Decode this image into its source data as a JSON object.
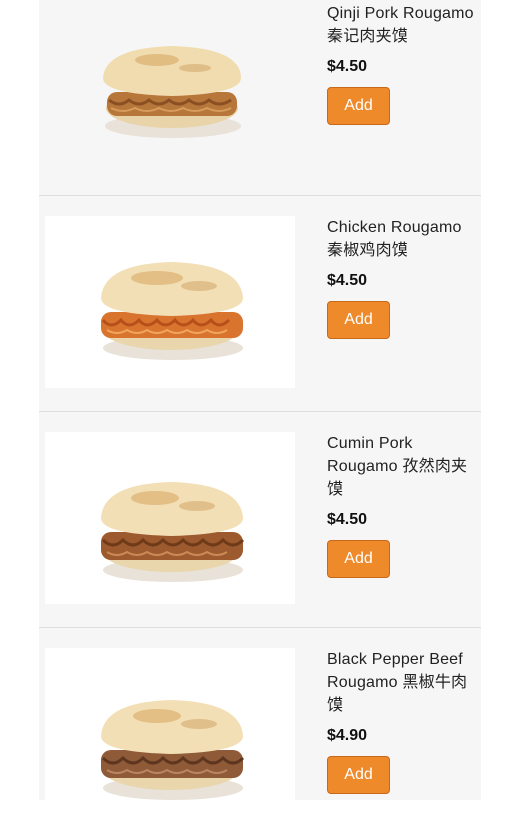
{
  "menu": {
    "items": [
      {
        "name": "Qinji Pork Rougamo 秦记肉夹馍",
        "price": "$4.50",
        "add_label": "Add",
        "image_icon": "rougamo-pork-image",
        "filling_color": "#b7773a"
      },
      {
        "name": "Chicken Rougamo 秦椒鸡肉馍",
        "price": "$4.50",
        "add_label": "Add",
        "image_icon": "rougamo-chicken-image",
        "filling_color": "#d8742e"
      },
      {
        "name": "Cumin Pork Rougamo 孜然肉夹馍",
        "price": "$4.50",
        "add_label": "Add",
        "image_icon": "rougamo-cumin-pork-image",
        "filling_color": "#9c5a2e"
      },
      {
        "name": "Black Pepper Beef Rougamo 黑椒牛肉馍",
        "price": "$4.90",
        "add_label": "Add",
        "image_icon": "rougamo-beef-image",
        "filling_color": "#8f5a38"
      }
    ]
  }
}
